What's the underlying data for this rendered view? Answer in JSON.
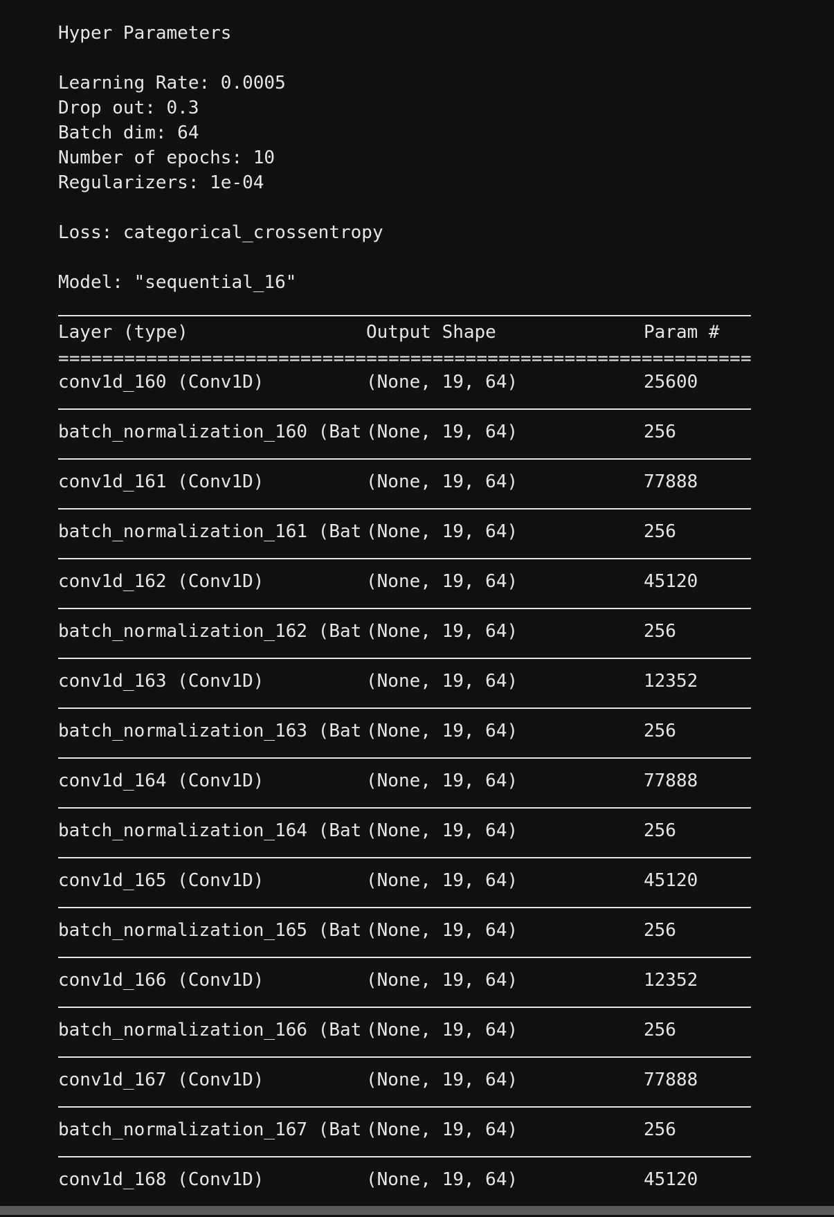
{
  "header": {
    "title": "Hyper Parameters",
    "learning_rate": "Learning Rate: 0.0005",
    "dropout": "Drop out: 0.3",
    "batch_dim": "Batch dim: 64",
    "epochs": "Number of epochs: 10",
    "regularizers": "Regularizers: 1e-04",
    "loss": "Loss: categorical_crossentropy",
    "model": "Model: \"sequential_16\""
  },
  "summary": {
    "columns": [
      "Layer (type)",
      "Output Shape",
      "Param #"
    ],
    "separator": "=================================================================",
    "rows": [
      {
        "layer": "conv1d_160 (Conv1D)",
        "shape": "(None, 19, 64)",
        "params": "25600"
      },
      {
        "layer": "batch_normalization_160 (Bat",
        "shape": "(None, 19, 64)",
        "params": "256"
      },
      {
        "layer": "conv1d_161 (Conv1D)",
        "shape": "(None, 19, 64)",
        "params": "77888"
      },
      {
        "layer": "batch_normalization_161 (Bat",
        "shape": "(None, 19, 64)",
        "params": "256"
      },
      {
        "layer": "conv1d_162 (Conv1D)",
        "shape": "(None, 19, 64)",
        "params": "45120"
      },
      {
        "layer": "batch_normalization_162 (Bat",
        "shape": "(None, 19, 64)",
        "params": "256"
      },
      {
        "layer": "conv1d_163 (Conv1D)",
        "shape": "(None, 19, 64)",
        "params": "12352"
      },
      {
        "layer": "batch_normalization_163 (Bat",
        "shape": "(None, 19, 64)",
        "params": "256"
      },
      {
        "layer": "conv1d_164 (Conv1D)",
        "shape": "(None, 19, 64)",
        "params": "77888"
      },
      {
        "layer": "batch_normalization_164 (Bat",
        "shape": "(None, 19, 64)",
        "params": "256"
      },
      {
        "layer": "conv1d_165 (Conv1D)",
        "shape": "(None, 19, 64)",
        "params": "45120"
      },
      {
        "layer": "batch_normalization_165 (Bat",
        "shape": "(None, 19, 64)",
        "params": "256"
      },
      {
        "layer": "conv1d_166 (Conv1D)",
        "shape": "(None, 19, 64)",
        "params": "12352"
      },
      {
        "layer": "batch_normalization_166 (Bat",
        "shape": "(None, 19, 64)",
        "params": "256"
      },
      {
        "layer": "conv1d_167 (Conv1D)",
        "shape": "(None, 19, 64)",
        "params": "77888"
      },
      {
        "layer": "batch_normalization_167 (Bat",
        "shape": "(None, 19, 64)",
        "params": "256"
      },
      {
        "layer": "conv1d_168 (Conv1D)",
        "shape": "(None, 19, 64)",
        "params": "45120"
      }
    ]
  },
  "colors": {
    "background": "#111111",
    "text": "#e6e6e6",
    "scrollbar": "#5a5a5a"
  }
}
